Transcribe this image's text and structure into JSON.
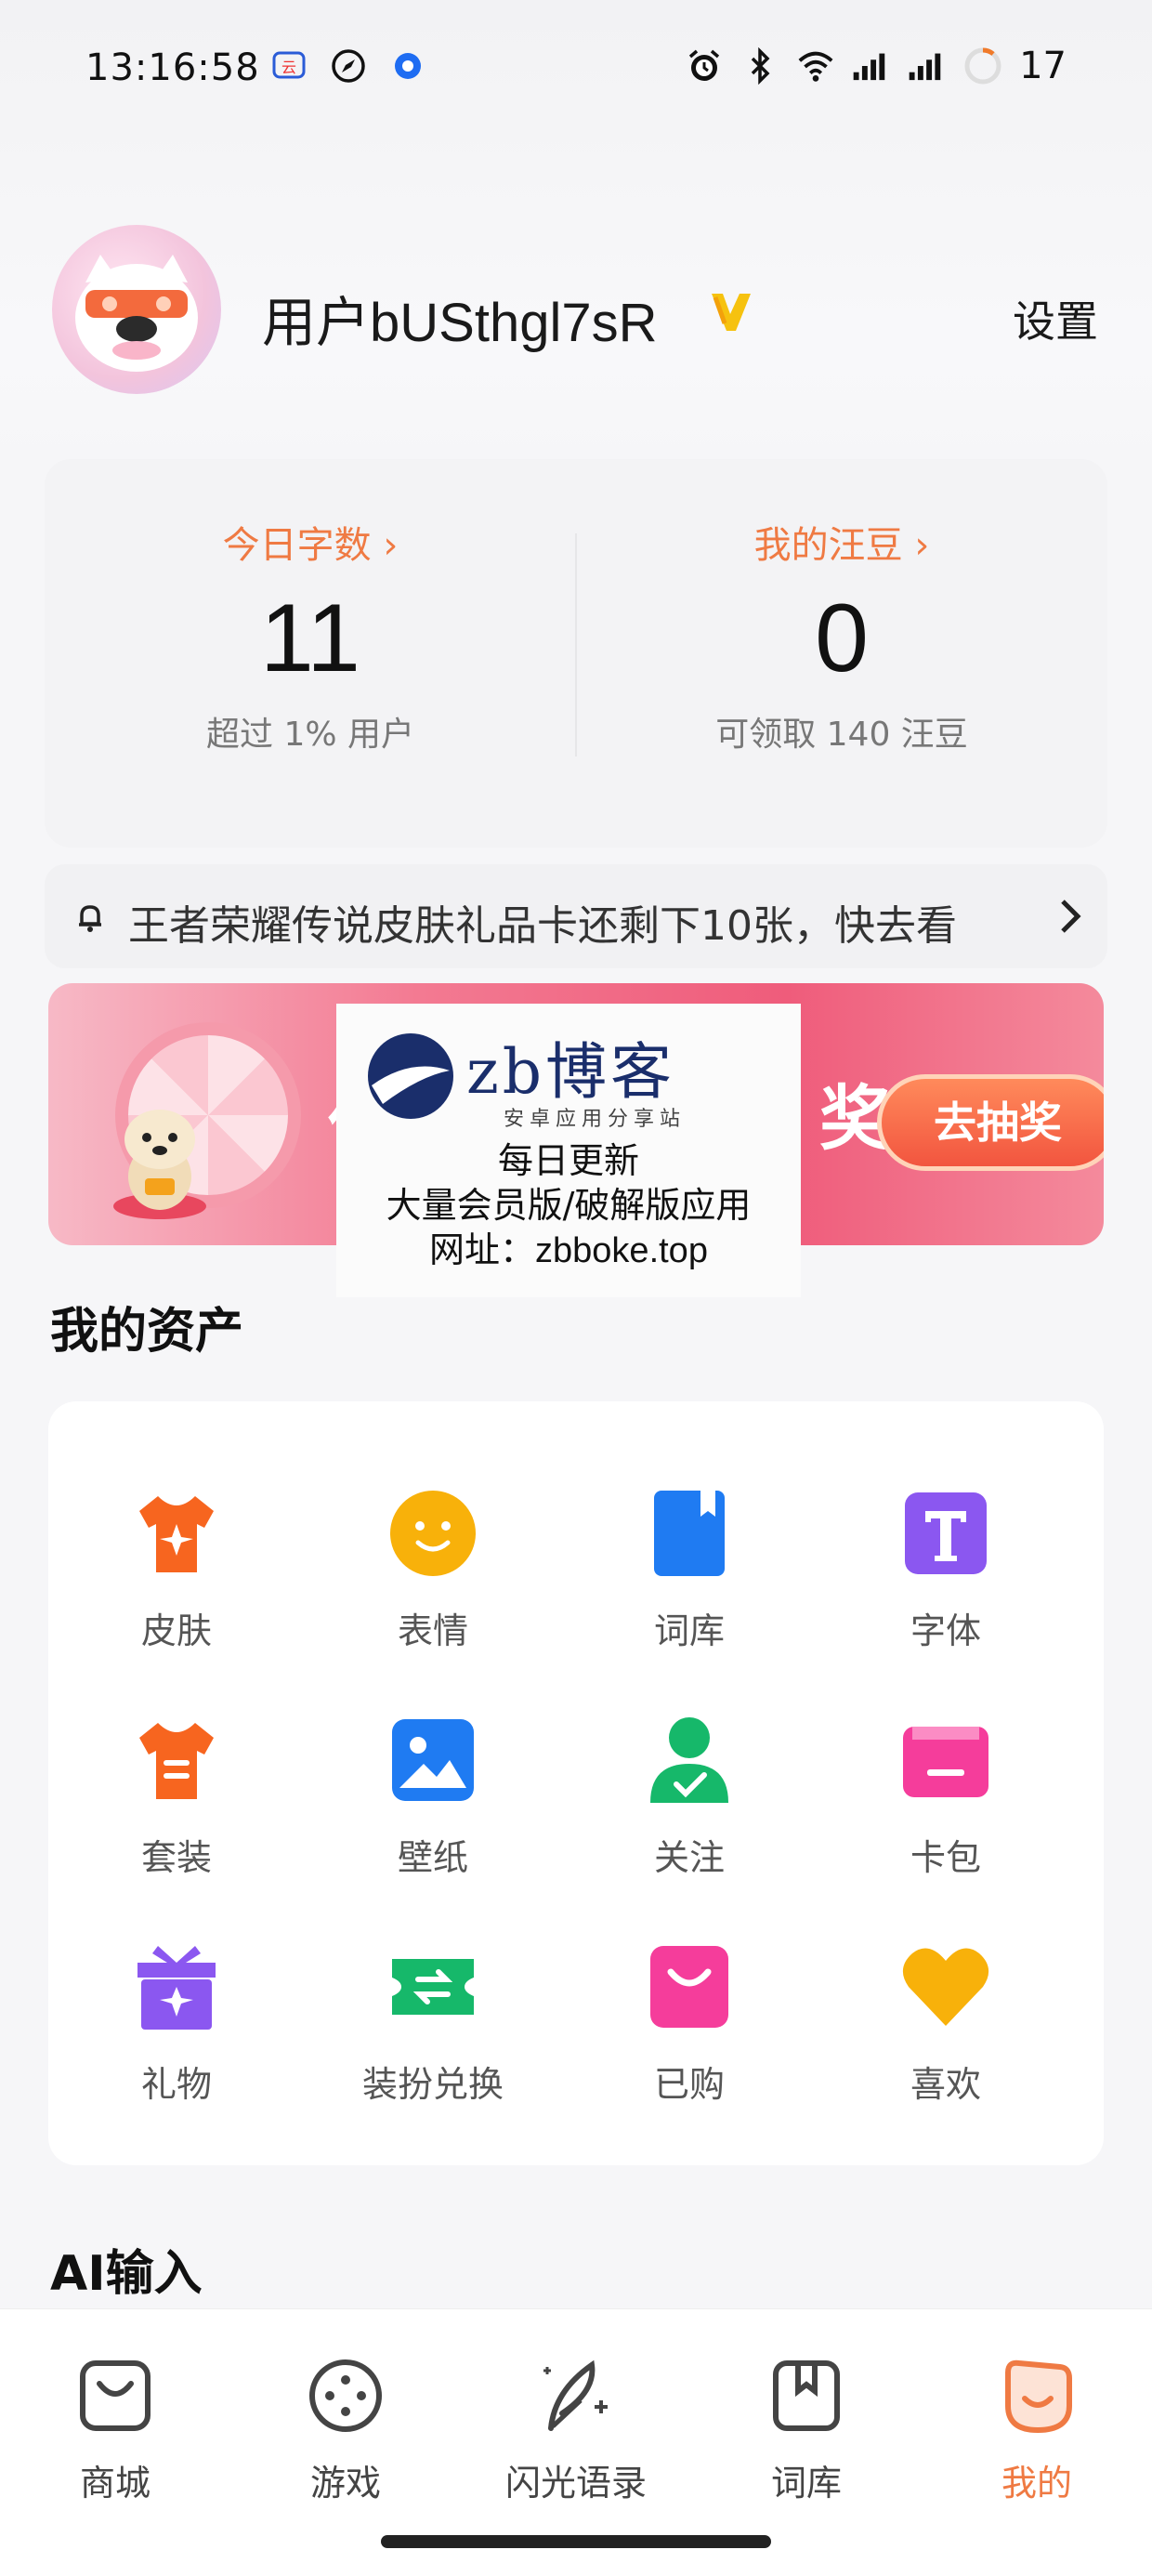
{
  "status_bar": {
    "time": "13:16:58",
    "battery": "17"
  },
  "profile": {
    "username": "用户bUSthgl7sR",
    "settings_label": "设置"
  },
  "stats": {
    "today_words_label": "今日字数 ›",
    "today_words_value": "11",
    "today_words_sub": "超过 1% 用户",
    "beans_label": "我的汪豆 ›",
    "beans_value": "0",
    "beans_sub": "可领取 140 汪豆"
  },
  "notice": {
    "text": "王者荣耀传说皮肤礼品卡还剩下10张，快去看"
  },
  "banner": {
    "title_left": "优",
    "title_right": "奖!",
    "button_label": "去抽奖"
  },
  "watermark": {
    "name": "zb博客",
    "sub": "安卓应用分享站",
    "line1": "每日更新",
    "line2": "大量会员版/破解版应用",
    "line3": "网址：zbboke.top"
  },
  "assets": {
    "title": "我的资产",
    "items": [
      {
        "label": "皮肤",
        "icon": "shirt-star-icon",
        "color": "#f7651f"
      },
      {
        "label": "表情",
        "icon": "smile-icon",
        "color": "#f8b10a"
      },
      {
        "label": "词库",
        "icon": "book-icon",
        "color": "#1f7bf2"
      },
      {
        "label": "字体",
        "icon": "font-t-icon",
        "color": "#8b57f0"
      },
      {
        "label": "套装",
        "icon": "shirt-equal-icon",
        "color": "#f7651f"
      },
      {
        "label": "壁纸",
        "icon": "image-icon",
        "color": "#1f7bf2"
      },
      {
        "label": "关注",
        "icon": "user-check-icon",
        "color": "#16b86a"
      },
      {
        "label": "卡包",
        "icon": "wallet-icon",
        "color": "#f53d9b"
      },
      {
        "label": "礼物",
        "icon": "gift-icon",
        "color": "#8b57f0"
      },
      {
        "label": "装扮兑换",
        "icon": "exchange-icon",
        "color": "#16b86a"
      },
      {
        "label": "已购",
        "icon": "shopping-bag-icon",
        "color": "#f53d9b"
      },
      {
        "label": "喜欢",
        "icon": "heart-icon",
        "color": "#f8b10a"
      }
    ]
  },
  "ai_section": {
    "title": "AI输入"
  },
  "nav": {
    "items": [
      {
        "label": "商城",
        "icon": "shop-bag-icon"
      },
      {
        "label": "游戏",
        "icon": "game-icon"
      },
      {
        "label": "闪光语录",
        "icon": "feather-icon"
      },
      {
        "label": "词库",
        "icon": "bookmark-book-icon"
      },
      {
        "label": "我的",
        "icon": "mine-icon",
        "active": true
      }
    ],
    "accent_color": "#ef7a43"
  }
}
